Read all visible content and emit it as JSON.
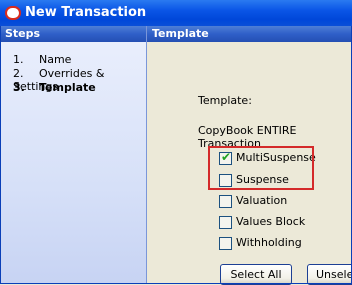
{
  "window": {
    "title": "New Transaction"
  },
  "steps": {
    "header": "Steps",
    "items": [
      {
        "num": "1.",
        "label": "Name"
      },
      {
        "num": "2.",
        "label": "Overrides & Settings"
      },
      {
        "num": "3.",
        "label": "Template"
      }
    ]
  },
  "template": {
    "header": "Template",
    "field_label": "Template:",
    "template_name": "CopyBook ENTIRE Transaction",
    "options": [
      {
        "label": "MultiSuspense",
        "checked": true
      },
      {
        "label": "Suspense",
        "checked": false
      },
      {
        "label": "Valuation",
        "checked": false
      },
      {
        "label": "Values Block",
        "checked": false
      },
      {
        "label": "Withholding",
        "checked": false
      }
    ],
    "select_all_label": "Select All",
    "unselect_label": "Unselect All"
  },
  "colors": {
    "title_bar": "#0a55e6",
    "highlight_border": "#d42a2a",
    "checkmark": "#21a121"
  }
}
